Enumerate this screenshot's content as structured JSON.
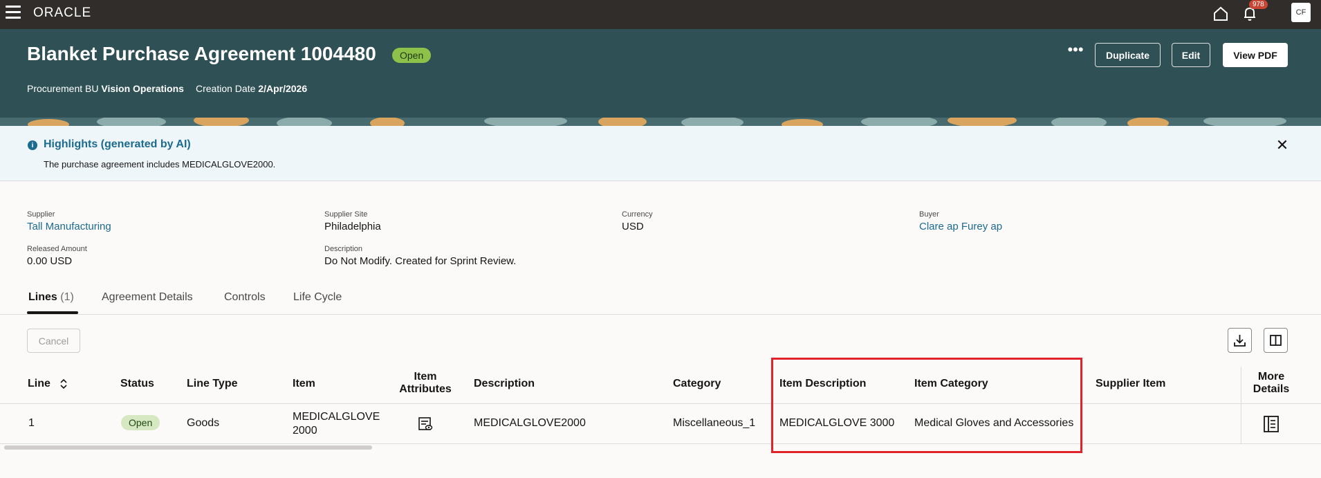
{
  "topbar": {
    "logo": "ORACLE",
    "notification_count": "978",
    "avatar_initials": "CF"
  },
  "header": {
    "title": "Blanket Purchase Agreement 1004480",
    "status": "Open",
    "procurement_bu_label": "Procurement BU",
    "procurement_bu_value": "Vision Operations",
    "creation_date_label": "Creation Date",
    "creation_date_value": "2/Apr/2026",
    "more_label": "•••",
    "duplicate_label": "Duplicate",
    "edit_label": "Edit",
    "view_pdf_label": "View PDF"
  },
  "banner": {
    "title": "Highlights (generated by AI)",
    "text": "The purchase agreement includes MEDICALGLOVE2000.",
    "close_label": "✕"
  },
  "fields": {
    "supplier_label": "Supplier",
    "supplier_value": "Tall Manufacturing",
    "supplier_site_label": "Supplier Site",
    "supplier_site_value": "Philadelphia",
    "currency_label": "Currency",
    "currency_value": "USD",
    "buyer_label": "Buyer",
    "buyer_value": "Clare ap Furey ap",
    "released_amount_label": "Released Amount",
    "released_amount_value": "0.00 USD",
    "description_label": "Description",
    "description_value": "Do Not Modify. Created for Sprint Review."
  },
  "tabs": {
    "lines_label": "Lines",
    "lines_count": "(1)",
    "agreement_details": "Agreement Details",
    "controls": "Controls",
    "life_cycle": "Life Cycle"
  },
  "toolbar": {
    "cancel_label": "Cancel"
  },
  "table": {
    "headers": {
      "line": "Line",
      "status": "Status",
      "line_type": "Line Type",
      "item": "Item",
      "item_attributes_1": "Item",
      "item_attributes_2": "Attributes",
      "description": "Description",
      "category": "Category",
      "item_description": "Item Description",
      "item_category": "Item Category",
      "supplier_item": "Supplier Item",
      "more_details_1": "More",
      "more_details_2": "Details"
    },
    "rows": [
      {
        "line": "1",
        "status": "Open",
        "line_type": "Goods",
        "item_1": "MEDICALGLOVE",
        "item_2": "2000",
        "description": "MEDICALGLOVE2000",
        "category": "Miscellaneous_1",
        "item_description": "MEDICALGLOVE 3000",
        "item_category": "Medical Gloves and Accessories",
        "supplier_item": ""
      }
    ]
  },
  "colors": {
    "topbar": "#312d2a",
    "header": "#2f5055",
    "banner_bg": "#eff6fa",
    "link": "#1c6a8e",
    "highlight": "#e0222a"
  }
}
